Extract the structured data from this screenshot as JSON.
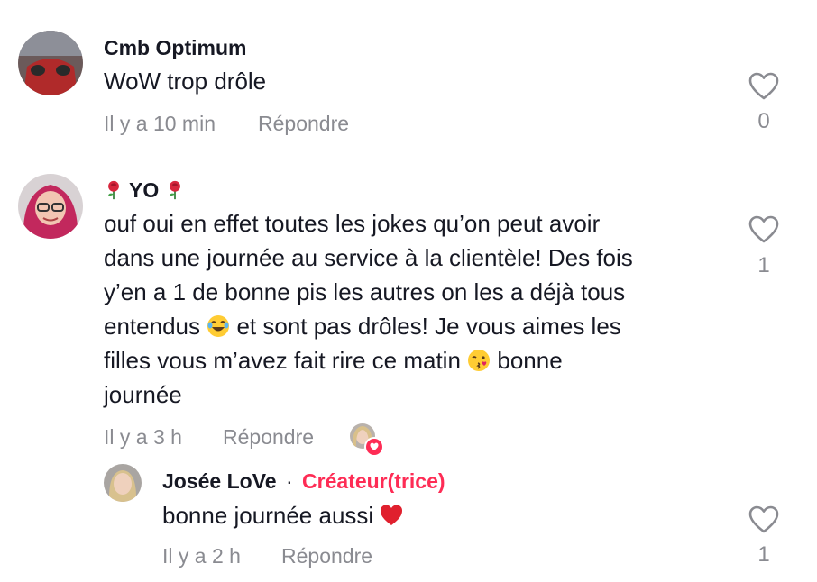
{
  "comments": [
    {
      "username": "Cmb Optimum",
      "text": "WoW trop drôle",
      "time": "Il y a 10 min",
      "reply_label": "Répondre",
      "likes": "0"
    },
    {
      "username_prefix_icon": "rose-emoji",
      "username": "YO",
      "username_suffix_icon": "rose-emoji",
      "text_lines": [
        "ouf oui en effet toutes les jokes qu’on peut avoir",
        "dans une journée au service à la clientèle! Des fois",
        "y’en a 1 de bonne pis les autres on les a déjà tous",
        "entendus",
        "et sont pas drôles! Je vous aimes les",
        "filles vous m’avez fait rire ce matin",
        "bonne",
        "journée"
      ],
      "time": "Il y a 3 h",
      "reply_label": "Répondre",
      "likes": "1",
      "creator_liked_icon": "creator-liked-avatar"
    }
  ],
  "reply": {
    "username": "Josée LoVe",
    "separator": "·",
    "badge": "Créateur(trice)",
    "text": "bonne journée aussi",
    "text_emoji": "red-heart-emoji",
    "time": "Il y a 2 h",
    "reply_label": "Répondre",
    "likes": "1"
  },
  "colors": {
    "text": "#161823",
    "muted": "#8a8b91",
    "accent": "#fe2c55"
  }
}
